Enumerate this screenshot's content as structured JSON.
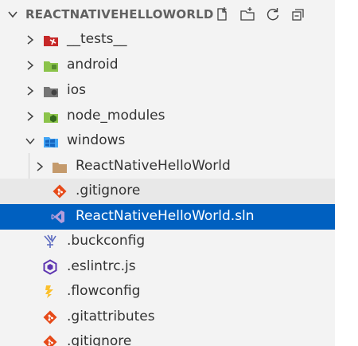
{
  "explorer": {
    "section_title": "REACTNATIVEHELLOWORLD",
    "actions": [
      "new-file-icon",
      "new-folder-icon",
      "refresh-icon",
      "collapse-all-icon"
    ]
  },
  "tree": {
    "tests": "__tests__",
    "android": "android",
    "ios": "ios",
    "node_modules": "node_modules",
    "windows": "windows",
    "rnhw_folder": "ReactNativeHelloWorld",
    "gitignore_inner": ".gitignore",
    "sln_file": "ReactNativeHelloWorld.sln",
    "buckconfig": ".buckconfig",
    "eslintrc": ".eslintrc.js",
    "flowconfig": ".flowconfig",
    "gitattributes": ".gitattributes",
    "gitignore_root": ".gitignore"
  },
  "colors": {
    "selection": "#0060c0",
    "hover": "#e8e8e8",
    "sidebar": "#f3f3f3"
  }
}
